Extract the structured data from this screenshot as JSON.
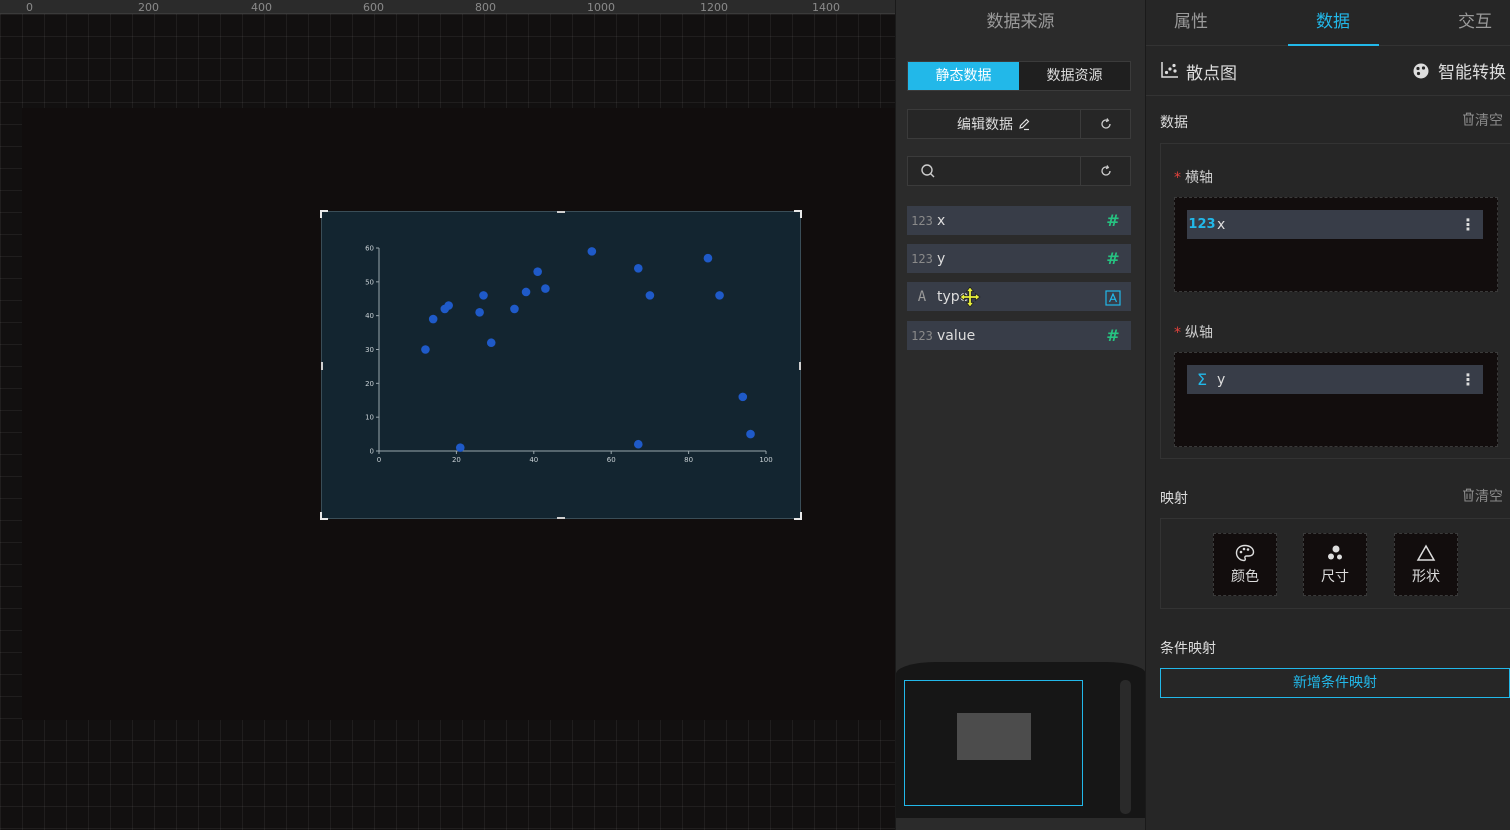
{
  "ruler": {
    "top_labels": [
      "0",
      "200",
      "400",
      "600",
      "800",
      "1000",
      "1200",
      "1400"
    ]
  },
  "chart_data": {
    "type": "scatter",
    "xlim": [
      0,
      100
    ],
    "ylim": [
      0,
      60
    ],
    "x_ticks": [
      "0",
      "20",
      "40",
      "60",
      "80",
      "100"
    ],
    "y_ticks": [
      "0",
      "10",
      "20",
      "30",
      "40",
      "50",
      "60"
    ],
    "color": "#1f5ac8",
    "points": [
      {
        "x": 12,
        "y": 30
      },
      {
        "x": 14,
        "y": 39
      },
      {
        "x": 17,
        "y": 42
      },
      {
        "x": 18,
        "y": 43
      },
      {
        "x": 21,
        "y": 1
      },
      {
        "x": 26,
        "y": 41
      },
      {
        "x": 27,
        "y": 46
      },
      {
        "x": 29,
        "y": 32
      },
      {
        "x": 35,
        "y": 42
      },
      {
        "x": 38,
        "y": 47
      },
      {
        "x": 41,
        "y": 53
      },
      {
        "x": 43,
        "y": 48
      },
      {
        "x": 55,
        "y": 59
      },
      {
        "x": 67,
        "y": 54
      },
      {
        "x": 67,
        "y": 2
      },
      {
        "x": 70,
        "y": 46
      },
      {
        "x": 85,
        "y": 57
      },
      {
        "x": 88,
        "y": 46
      },
      {
        "x": 94,
        "y": 16
      },
      {
        "x": 96,
        "y": 5
      }
    ]
  },
  "datasource": {
    "title": "数据来源",
    "mode_static": "静态数据",
    "mode_resource": "数据资源",
    "edit_data": "编辑数据",
    "search_placeholder": "",
    "fields": [
      {
        "type": "123",
        "name": "x"
      },
      {
        "type": "123",
        "name": "y"
      },
      {
        "type": "A",
        "name": "type"
      },
      {
        "type": "123",
        "name": "value"
      }
    ]
  },
  "config": {
    "tabs": [
      "属性",
      "数据",
      "交互"
    ],
    "chart_type": "散点图",
    "smart_convert": "智能转换",
    "data_title": "数据",
    "clear": "清空",
    "x_axis_label": "横轴",
    "y_axis_label": "纵轴",
    "x_axis_field": {
      "type": "123",
      "name": "x"
    },
    "y_axis_field": {
      "type": "Σ",
      "name": "y"
    },
    "mapping_title": "映射",
    "mapping_buttons": [
      "颜色",
      "尺寸",
      "形状"
    ],
    "cond_title": "条件映射",
    "add_cond": "新增条件映射"
  }
}
